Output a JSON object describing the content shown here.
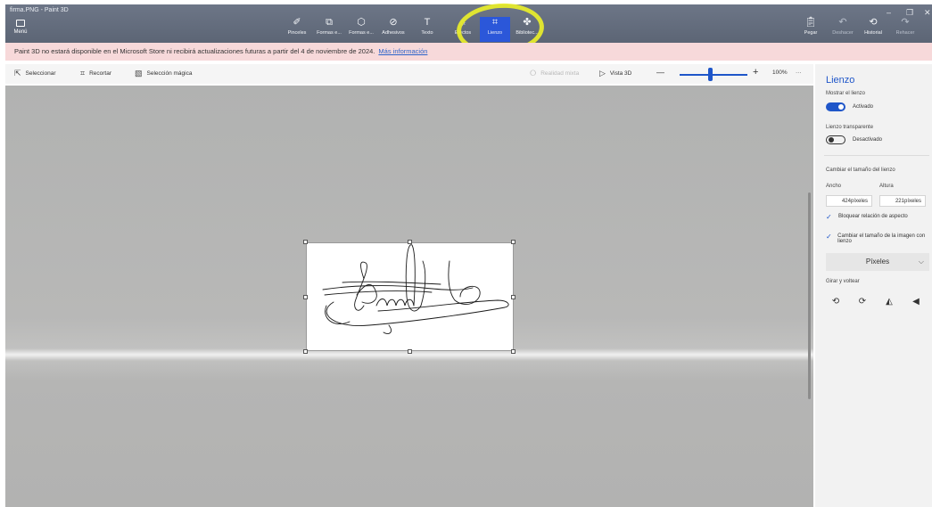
{
  "window": {
    "title": "firma.PNG - Paint 3D"
  },
  "ribbon": {
    "menu_label": "Menú",
    "tools": [
      {
        "name": "brushes",
        "label": "Pinceles",
        "glyph": "✐"
      },
      {
        "name": "2d-shapes",
        "label": "Formas e...",
        "glyph": "⧉"
      },
      {
        "name": "3d-shapes",
        "label": "Formas e...",
        "glyph": "⬡"
      },
      {
        "name": "stickers",
        "label": "Adhesivos",
        "glyph": "⊘"
      },
      {
        "name": "text",
        "label": "Texto",
        "glyph": "T"
      },
      {
        "name": "effects",
        "label": "Efectos",
        "glyph": "☼"
      },
      {
        "name": "canvas",
        "label": "Lienzo",
        "glyph": "⌗"
      },
      {
        "name": "library",
        "label": "Bibliotec...",
        "glyph": "✤"
      }
    ],
    "active_tool": "canvas",
    "paste_label": "Pegar",
    "undo_label": "Deshacer",
    "history_label": "Historial",
    "redo_label": "Rehacer"
  },
  "banner": {
    "message": "Paint 3D no estará disponible en el Microsoft Store ni recibirá actualizaciones futuras a partir del 4 de noviembre de 2024.",
    "link": "Más información"
  },
  "toolbar": {
    "select_label": "Seleccionar",
    "crop_label": "Recortar",
    "magic_select_label": "Selección mágica",
    "mixed_reality_label": "Realidad mixta",
    "view3d_label": "Vista 3D",
    "zoom_value": "100%",
    "zoom_minus": "—",
    "zoom_plus": "+",
    "more": "···",
    "zoom_level": 0.45
  },
  "panel": {
    "title": "Lienzo",
    "show_canvas_label": "Mostrar el lienzo",
    "show_canvas_state": "Activado",
    "transparent_label": "Lienzo transparente",
    "transparent_state": "Desactivado",
    "resize_label": "Cambiar el tamaño del lienzo",
    "width_label": "Ancho",
    "height_label": "Altura",
    "width_value": "424píxeles",
    "height_value": "221píxeles",
    "lock_aspect_label": "Bloquear relación de aspecto",
    "resize_image_label": "Cambiar el tamaño de la imagen con lienzo",
    "units_value": "Píxeles",
    "rotate_flip_label": "Girar y voltear"
  },
  "colors": {
    "accent": "#1f56c9",
    "ribbon": "#626b7b",
    "banner": "#f7d9da",
    "highlight_annotation": "#e9ee2a"
  }
}
